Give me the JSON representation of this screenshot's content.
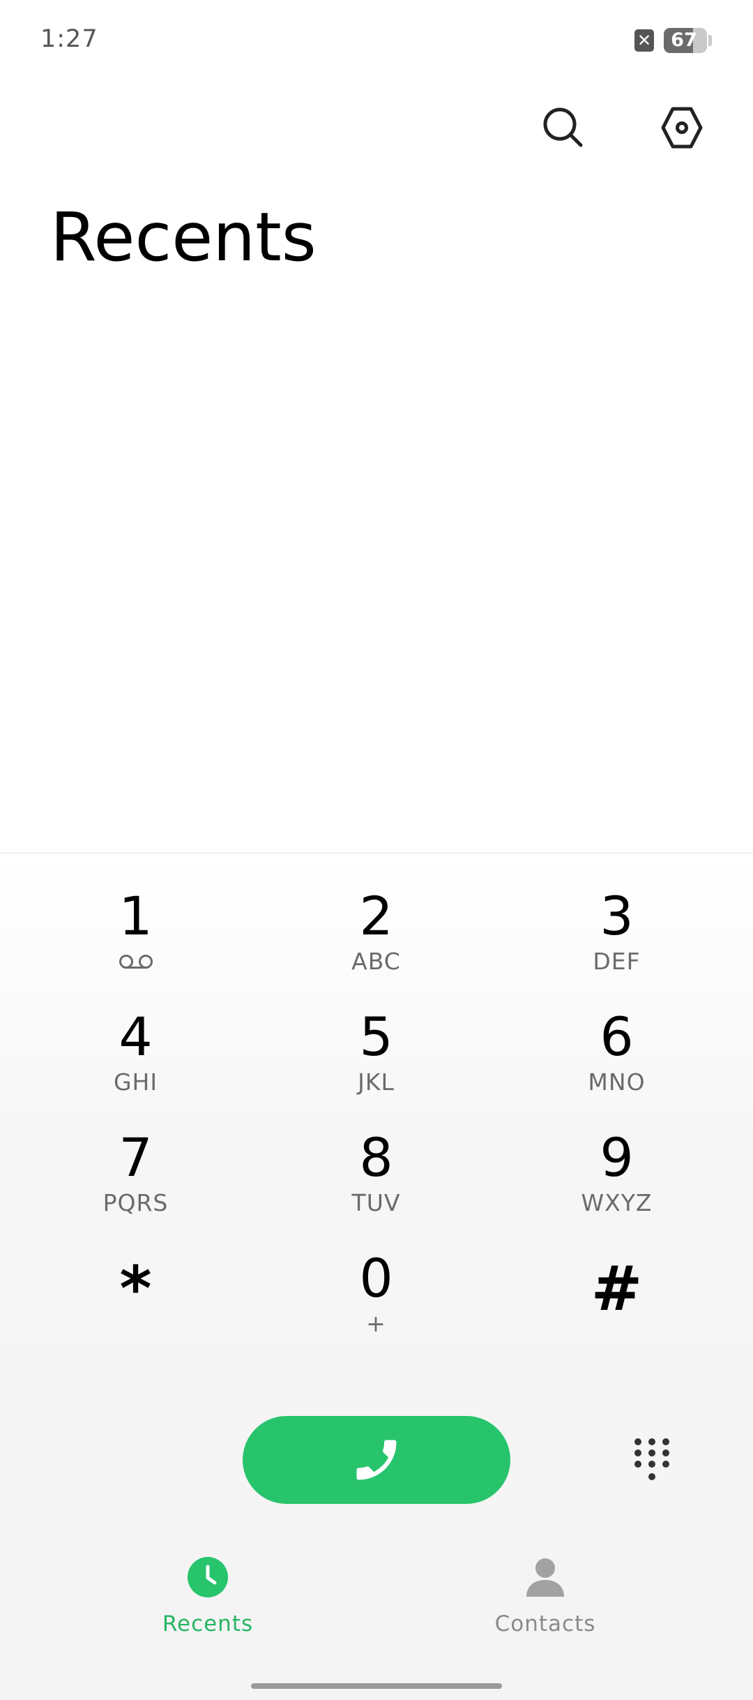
{
  "status_bar": {
    "time": "1:27",
    "sim_icon": "sim-missing-icon",
    "battery_level": "67",
    "battery_fraction": 0.67
  },
  "header": {
    "search_icon": "search-icon",
    "settings_icon": "settings-icon",
    "title": "Recents"
  },
  "dialpad": {
    "keys": [
      {
        "digit": "1",
        "letters": "",
        "icon": "voicemail-icon"
      },
      {
        "digit": "2",
        "letters": "ABC"
      },
      {
        "digit": "3",
        "letters": "DEF"
      },
      {
        "digit": "4",
        "letters": "GHI"
      },
      {
        "digit": "5",
        "letters": "JKL"
      },
      {
        "digit": "6",
        "letters": "MNO"
      },
      {
        "digit": "7",
        "letters": "PQRS"
      },
      {
        "digit": "8",
        "letters": "TUV"
      },
      {
        "digit": "9",
        "letters": "WXYZ"
      },
      {
        "digit": "*",
        "letters": ""
      },
      {
        "digit": "0",
        "letters": "+"
      },
      {
        "digit": "#",
        "letters": ""
      }
    ],
    "call_icon": "phone-icon",
    "toggle_icon": "dialpad-icon"
  },
  "bottom_nav": {
    "items": [
      {
        "label": "Recents",
        "icon": "clock-icon",
        "active": true
      },
      {
        "label": "Contacts",
        "icon": "person-icon",
        "active": false
      }
    ]
  },
  "colors": {
    "accent": "#27c46c",
    "active_label": "#27b564",
    "inactive": "#8a8a8a"
  }
}
